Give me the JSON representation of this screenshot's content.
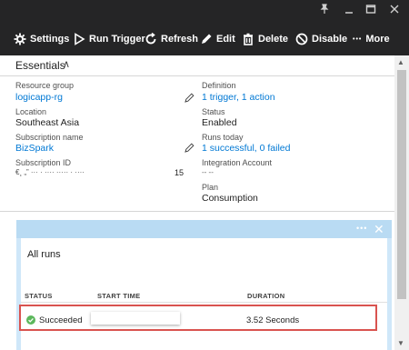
{
  "window_controls": {
    "pin": "pin-icon",
    "minimize": "minimize-icon",
    "maximize": "maximize-icon",
    "close": "close-icon"
  },
  "toolbar": {
    "settings": "Settings",
    "run_trigger": "Run Trigger",
    "refresh": "Refresh",
    "edit": "Edit",
    "delete": "Delete",
    "disable": "Disable",
    "more": "More",
    "more_icon": "•••"
  },
  "essentials": {
    "title": "Essentials",
    "chevron": "∧",
    "resource_group_label": "Resource group",
    "resource_group_value": "logicapp-rg",
    "location_label": "Location",
    "location_value": "Southeast Asia",
    "subscription_name_label": "Subscription name",
    "subscription_name_value": "BizSpark",
    "subscription_id_label": "Subscription ID",
    "subscription_id_value": "€¸ „” ··· · ···· ····· · ····",
    "subscription_id_suffix": "15",
    "definition_label": "Definition",
    "definition_value": "1 trigger, 1 action",
    "status_label": "Status",
    "status_value": "Enabled",
    "runs_today_label": "Runs today",
    "runs_today_value": "1 successful, 0 failed",
    "integration_account_label": "Integration Account",
    "integration_account_value": "-- --",
    "plan_label": "Plan",
    "plan_value": "Consumption"
  },
  "runs_blade": {
    "more_icon": "•••",
    "close_icon": "✕",
    "title": "All runs",
    "columns": {
      "status": "STATUS",
      "start_time": "START TIME",
      "duration": "DURATION"
    },
    "rows": [
      {
        "status": "Succeeded",
        "start_time": "",
        "duration": "3.52 Seconds"
      }
    ]
  },
  "colors": {
    "accent": "#0078d4",
    "top_bar": "#252526",
    "blade_header": "#b9dbf3",
    "highlight": "#d9534f",
    "success": "#5cb85c"
  }
}
